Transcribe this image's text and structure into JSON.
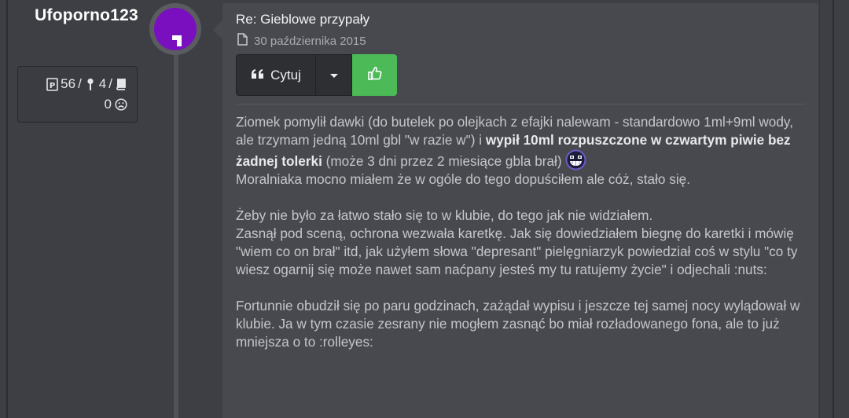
{
  "author": {
    "name": "Ufoporno123",
    "stats": {
      "posts": "56",
      "sep1": "/",
      "trips": "4",
      "sep2": "/",
      "reputation": "0"
    }
  },
  "post": {
    "title": "Re: Gieblowe przypały",
    "date": "30 października 2015",
    "buttons": {
      "quote_label": "Cytuj"
    },
    "body": {
      "p1_a": "Ziomek pomylił dawki (do butelek po olejkach z efajki nalewam - standardowo 1ml+9ml wody, ale trzymam jedną 10ml gbl \"w razie w\") i ",
      "p1_bold": "wypił 10ml rozpuszczone w czwartym piwie bez żadnej tolerki",
      "p1_b": " (może 3 dni przez 2 miesiące gbla brał)",
      "p1_c": "Moralniaka mocno miałem że w ogóle do tego dopuściłem ale cóż, stało się.",
      "p2_a": "Żeby nie było za łatwo stało się to w klubie, do tego jak nie widziałem.",
      "p2_b": "Zasnął pod sceną, ochrona wezwała karetkę. Jak się dowiedziałem biegnę do karetki i mówię \"wiem co on brał\" itd, jak użyłem słowa \"depresant\" pielęgniarzyk powiedział coś w stylu \"co ty wiesz ogarnij się może nawet sam naćpany jesteś my tu ratujemy życie\" i odjechali :nuts:",
      "p3": "Fortunnie obudził się po paru godzinach, zażądał wypisu i jeszcze tej samej nocy wylądował w klubie. Ja w tym czasie zesrany nie mogłem zasnąć bo miał rozładowanego fona, ale to już mniejsza o to :rolleyes:"
    }
  },
  "icons": {
    "posts": "document-p-icon",
    "trips": "pin-icon",
    "reports": "book-icon",
    "reputation": "sad-face-icon",
    "date": "document-icon",
    "quote": "quote-icon",
    "dropdown": "caret-down-icon",
    "like": "thumbs-up-icon",
    "emoji": "grin-smiley-icon"
  },
  "colors": {
    "avatar": "#7a0fbf",
    "like_button": "#4cba56",
    "background": "#3d3f44",
    "post_panel": "#47494e"
  }
}
